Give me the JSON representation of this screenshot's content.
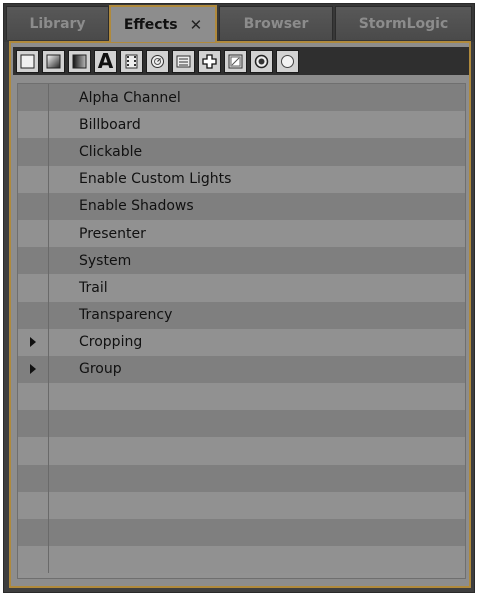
{
  "tabs": [
    {
      "label": "Library",
      "active": false
    },
    {
      "label": "Effects",
      "active": true,
      "close": "✕"
    },
    {
      "label": "Browser",
      "active": false
    },
    {
      "label": "StormLogic",
      "active": false
    }
  ],
  "toolbar": {
    "icons": [
      "blank-square-icon",
      "gradient-light-icon",
      "gradient-dark-icon",
      "text-a-icon",
      "filmstrip-icon",
      "dial-icon",
      "list-lines-icon",
      "plus-cross-icon",
      "image-frame-icon",
      "ring-icon",
      "circle-icon"
    ],
    "text_icon_glyph": "A"
  },
  "effects_list": {
    "items": [
      {
        "label": "Alpha Channel",
        "expandable": false
      },
      {
        "label": "Billboard",
        "expandable": false
      },
      {
        "label": "Clickable",
        "expandable": false
      },
      {
        "label": "Enable Custom Lights",
        "expandable": false
      },
      {
        "label": "Enable Shadows",
        "expandable": false
      },
      {
        "label": "Presenter",
        "expandable": false
      },
      {
        "label": "System",
        "expandable": false
      },
      {
        "label": "Trail",
        "expandable": false
      },
      {
        "label": "Transparency",
        "expandable": false
      },
      {
        "label": "Cropping",
        "expandable": true
      },
      {
        "label": "Group",
        "expandable": true
      }
    ]
  },
  "colors": {
    "accent_border": "#b08a3c",
    "panel_background": "#8d8d8d"
  }
}
